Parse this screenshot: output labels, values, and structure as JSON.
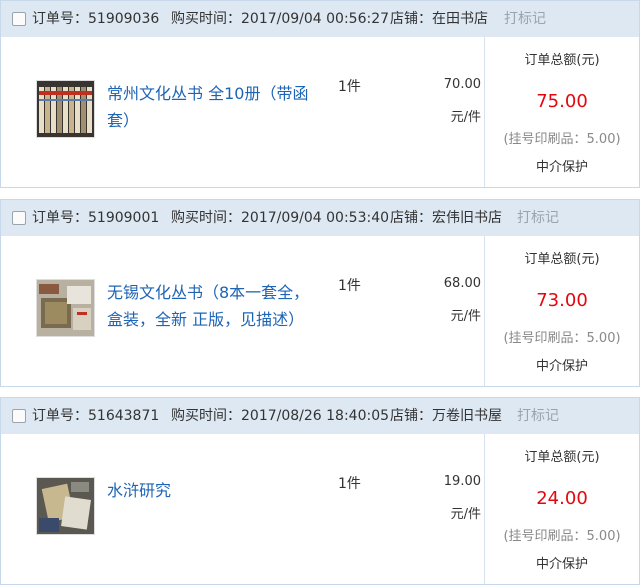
{
  "orders": [
    {
      "order_label": "订单号：",
      "order_no": "51909036",
      "time_label": "购买时间：",
      "time": "2017/09/04 00:56:27",
      "shop_label": "店铺：",
      "shop": "在田书店",
      "mark_label": "打标记",
      "item_title": "常州文化丛书 全10册（带函套）",
      "qty": "1件",
      "price": "70.00",
      "unit": "元/件",
      "total_label": "订单总额(元)",
      "total": "75.00",
      "shipping": "(挂号印刷品：5.00)",
      "guarantee": "中介保护"
    },
    {
      "order_label": "订单号：",
      "order_no": "51909001",
      "time_label": "购买时间：",
      "time": "2017/09/04 00:53:40",
      "shop_label": "店铺：",
      "shop": "宏伟旧书店",
      "mark_label": "打标记",
      "item_title": "无锡文化丛书（8本一套全，盒装，全新 正版，见描述）",
      "qty": "1件",
      "price": "68.00",
      "unit": "元/件",
      "total_label": "订单总额(元)",
      "total": "73.00",
      "shipping": "(挂号印刷品：5.00)",
      "guarantee": "中介保护"
    },
    {
      "order_label": "订单号：",
      "order_no": "51643871",
      "time_label": "购买时间：",
      "time": "2017/08/26 18:40:05",
      "shop_label": "店铺：",
      "shop": "万卷旧书屋",
      "mark_label": "打标记",
      "item_title": "水浒研究",
      "qty": "1件",
      "price": "19.00",
      "unit": "元/件",
      "total_label": "订单总额(元)",
      "total": "24.00",
      "shipping": "(挂号印刷品：5.00)",
      "guarantee": "中介保护"
    }
  ],
  "colors": {
    "header_bg": "#dde8f3",
    "link": "#1e64b4",
    "total": "#e3080e",
    "muted": "#9aa4ae"
  }
}
